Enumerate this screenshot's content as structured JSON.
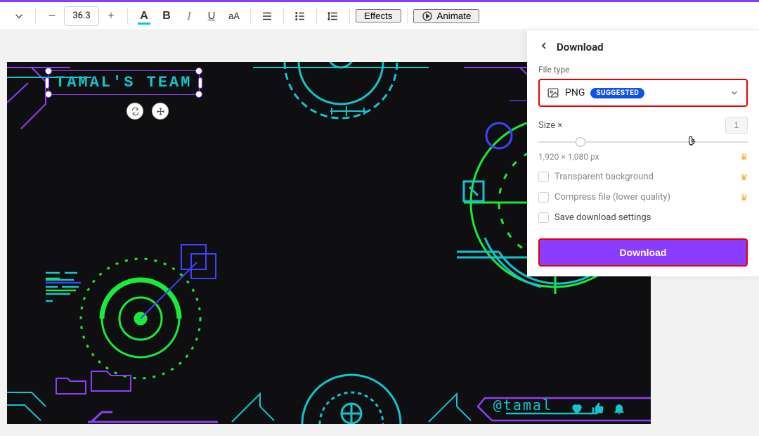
{
  "toolbar": {
    "font_size": "36.3",
    "effects": "Effects",
    "animate": "Animate"
  },
  "canvas": {
    "title_text": "TAMAL'S TEAM",
    "handle_text": "@tamal"
  },
  "panel": {
    "title": "Download",
    "filetype_label": "File type",
    "filetype_value": "PNG",
    "suggested_badge": "SUGGESTED",
    "size_label": "Size ×",
    "size_value": "1",
    "dimensions": "1,920 × 1,080 px",
    "opt_transparent": "Transparent background",
    "opt_compress": "Compress file (lower quality)",
    "opt_save": "Save download settings",
    "download_btn": "Download"
  }
}
